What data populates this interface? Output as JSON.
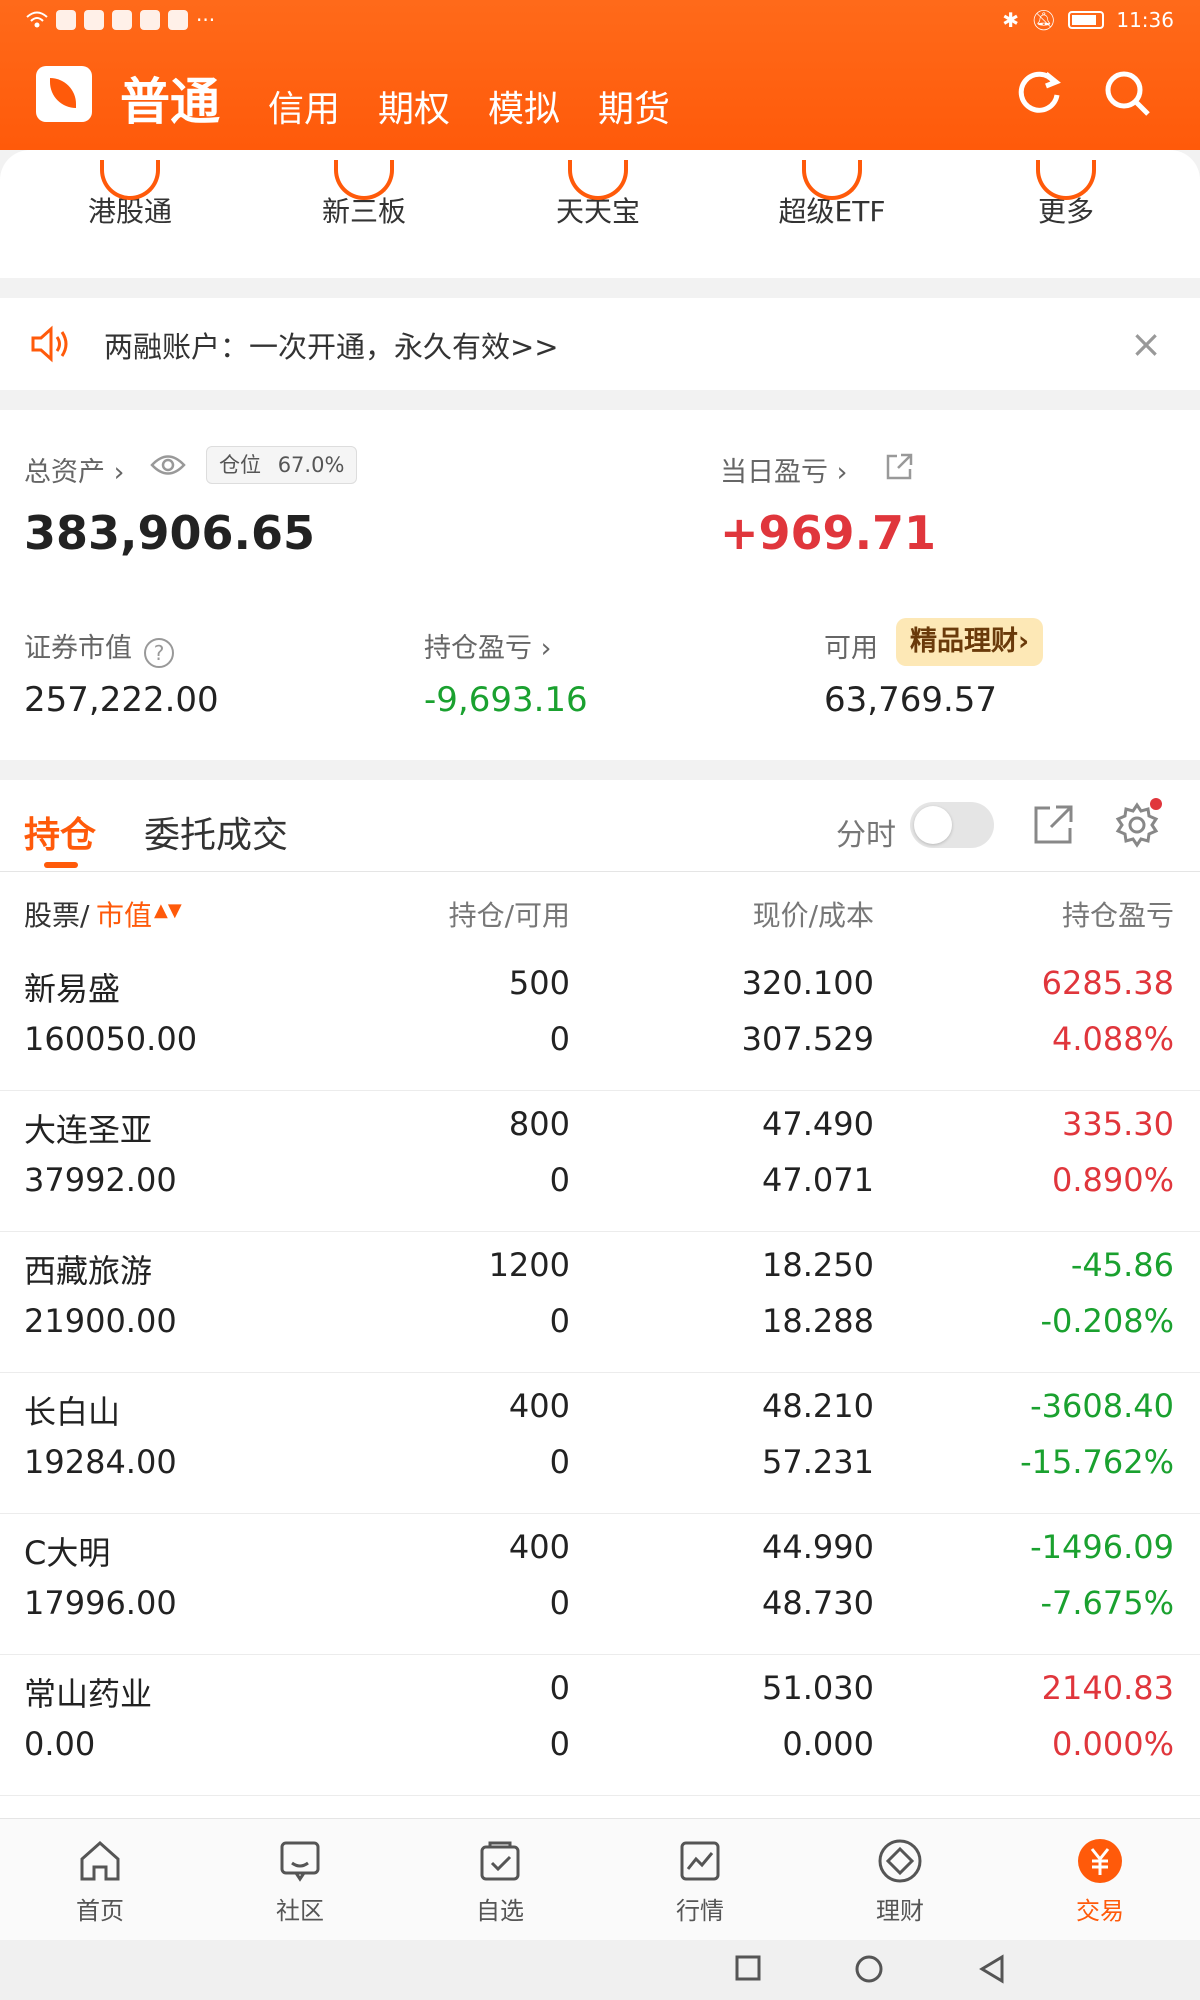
{
  "statusbar": {
    "time": "11:36",
    "more": "···"
  },
  "header": {
    "main_title": "普通",
    "tabs": [
      "信用",
      "期权",
      "模拟",
      "期货"
    ]
  },
  "quick_menu": {
    "items": [
      "港股通",
      "新三板",
      "天天宝",
      "超级ETF",
      "更多"
    ]
  },
  "notice": {
    "text": "两融账户：一次开通，永久有效>>"
  },
  "assets": {
    "total_label": "总资产 ›",
    "position_label": "仓位",
    "position_value": "67.0%",
    "total_value": "383,906.65",
    "daily_pl_label": "当日盈亏 ›",
    "daily_pl_value": "+969.71",
    "market_value_label": "证券市值",
    "market_value": "257,222.00",
    "hold_pl_label": "持仓盈亏 ›",
    "hold_pl_value": "-9,693.16",
    "available_label": "可用",
    "available_value": "63,769.57",
    "finance_badge": "精品理财›"
  },
  "holdings": {
    "tab_active": "持仓",
    "tab_other": "委托成交",
    "toggle_label": "分时",
    "columns": {
      "stock": "股票/",
      "stock_sort": "市值",
      "qty": "持仓/可用",
      "price": "现价/成本",
      "pl": "持仓盈亏"
    },
    "rows": [
      {
        "name": "新易盛",
        "mv": "160050.00",
        "qty": "500",
        "avail": "0",
        "price": "320.100",
        "cost": "307.529",
        "pl": "6285.38",
        "plpct": "4.088%",
        "sign": "up"
      },
      {
        "name": "大连圣亚",
        "mv": "37992.00",
        "qty": "800",
        "avail": "0",
        "price": "47.490",
        "cost": "47.071",
        "pl": "335.30",
        "plpct": "0.890%",
        "sign": "up"
      },
      {
        "name": "西藏旅游",
        "mv": "21900.00",
        "qty": "1200",
        "avail": "0",
        "price": "18.250",
        "cost": "18.288",
        "pl": "-45.86",
        "plpct": "-0.208%",
        "sign": "down"
      },
      {
        "name": "长白山",
        "mv": "19284.00",
        "qty": "400",
        "avail": "0",
        "price": "48.210",
        "cost": "57.231",
        "pl": "-3608.40",
        "plpct": "-15.762%",
        "sign": "down"
      },
      {
        "name": "C大明",
        "mv": "17996.00",
        "qty": "400",
        "avail": "0",
        "price": "44.990",
        "cost": "48.730",
        "pl": "-1496.09",
        "plpct": "-7.675%",
        "sign": "down"
      },
      {
        "name": "常山药业",
        "mv": "0.00",
        "qty": "0",
        "avail": "0",
        "price": "51.030",
        "cost": "0.000",
        "pl": "2140.83",
        "plpct": "0.000%",
        "sign": "up"
      }
    ]
  },
  "bottom_nav": {
    "items": [
      "首页",
      "社区",
      "自选",
      "行情",
      "理财",
      "交易"
    ]
  },
  "colors": {
    "accent": "#ff5a0a",
    "up": "#e0363c",
    "down": "#1aa12f"
  }
}
